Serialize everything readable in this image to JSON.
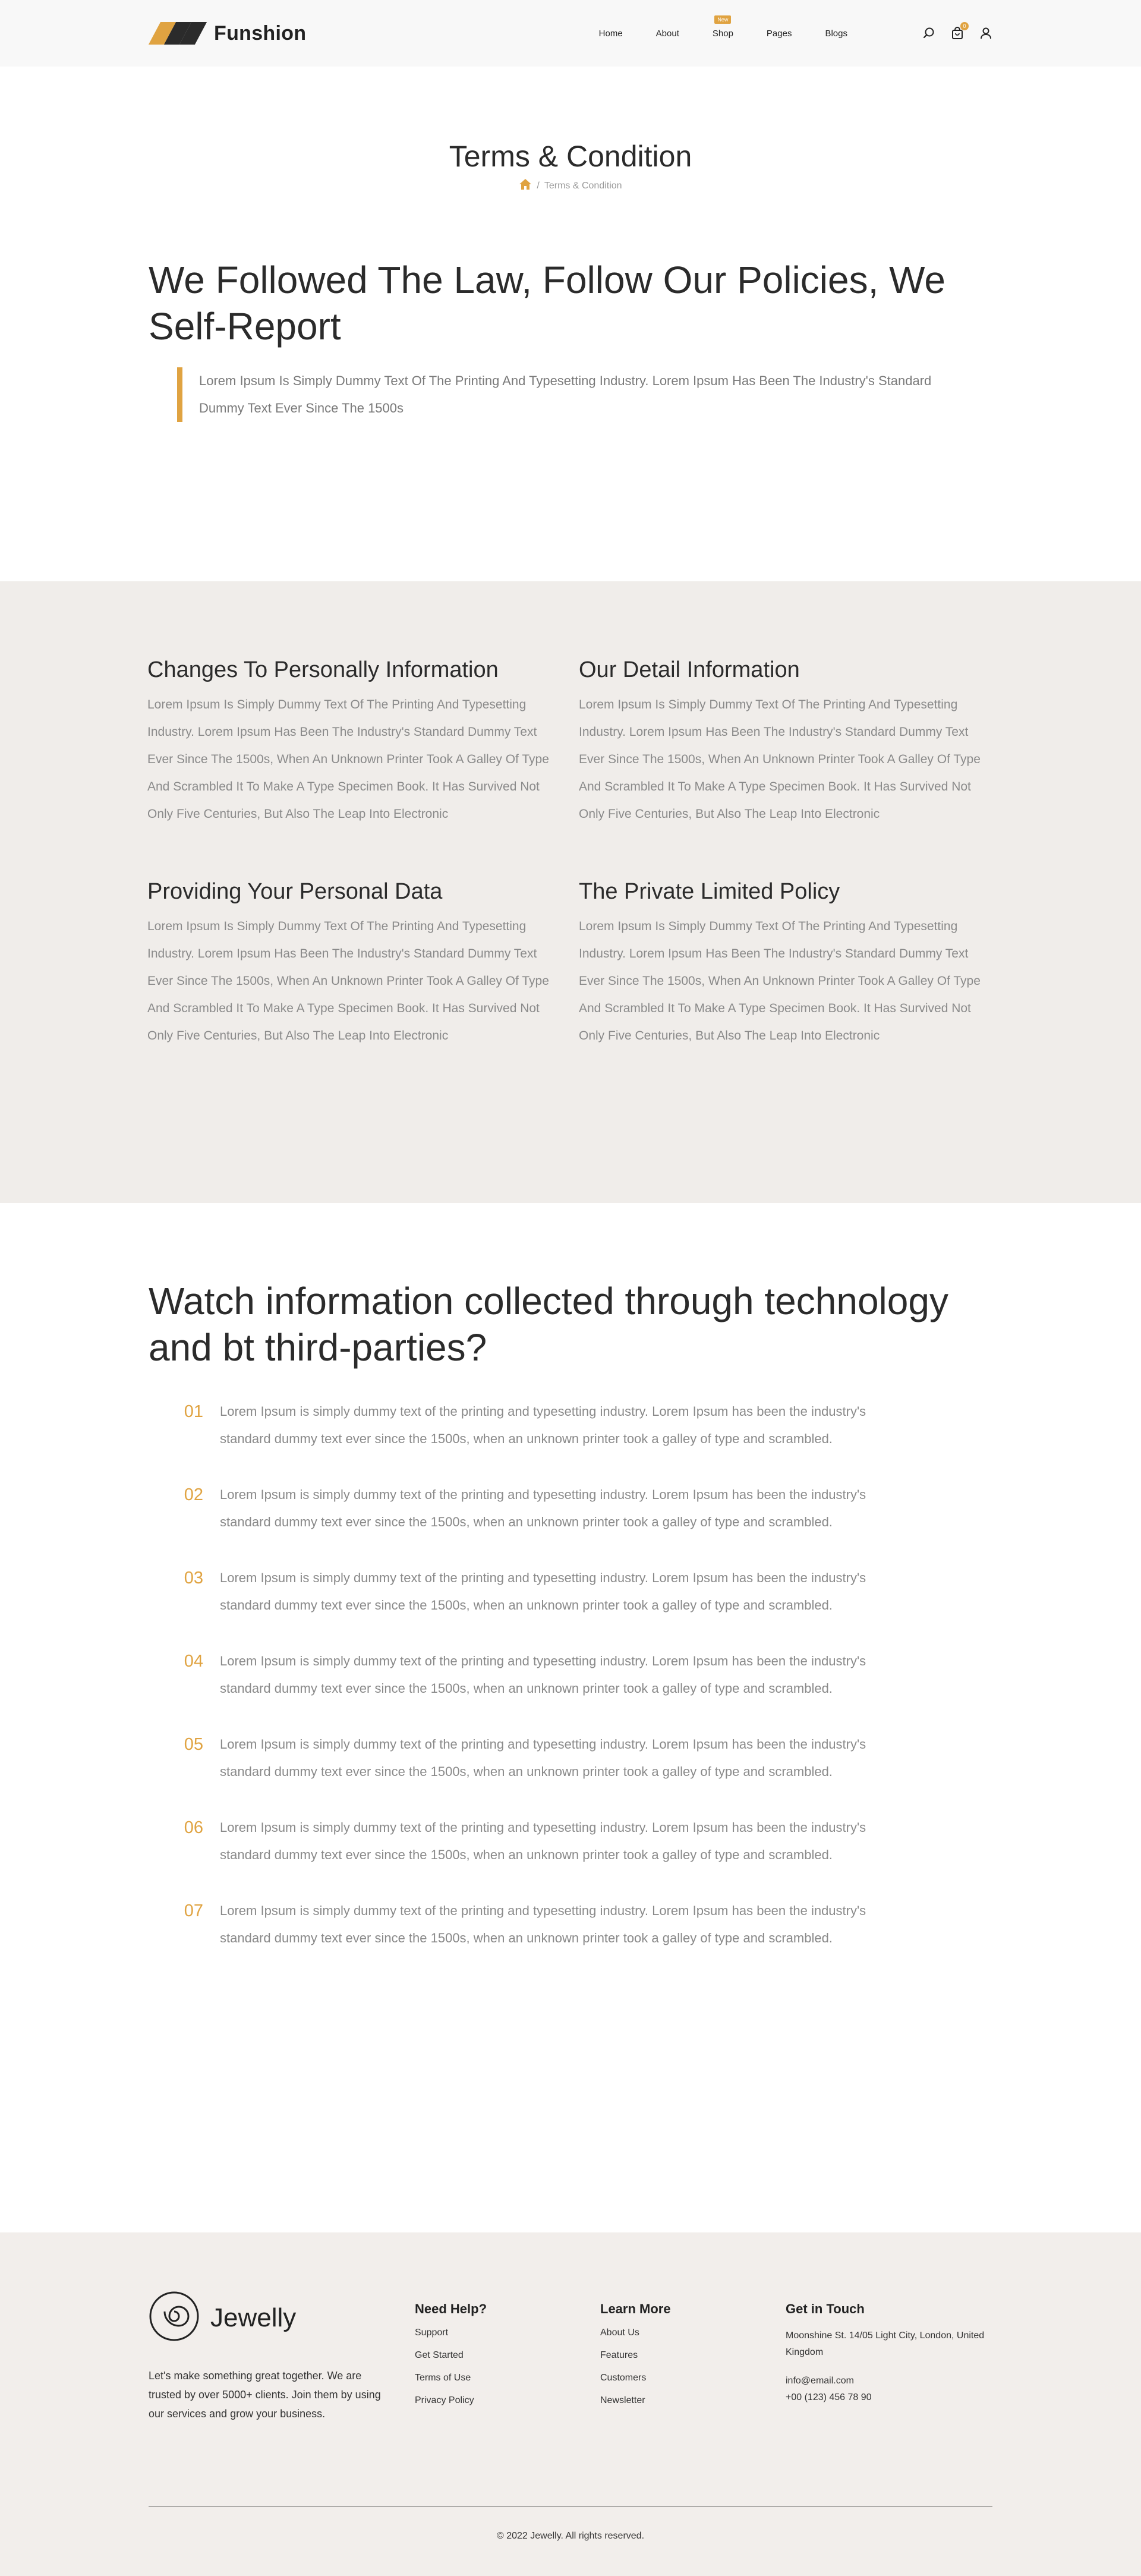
{
  "header": {
    "brand": "Funshion",
    "nav": [
      {
        "label": "Home",
        "badge": ""
      },
      {
        "label": "About",
        "badge": ""
      },
      {
        "label": "Shop",
        "badge": "New"
      },
      {
        "label": "Pages",
        "badge": ""
      },
      {
        "label": "Blogs",
        "badge": ""
      }
    ],
    "cart_count": "0"
  },
  "page": {
    "title": "Terms & Condition",
    "breadcrumb_current": "Terms & Condition"
  },
  "intro": {
    "heading": "We Followed The Law, Follow Our Policies, We Self-Report",
    "quote": "Lorem Ipsum Is Simply Dummy Text Of The Printing And Typesetting Industry. Lorem Ipsum Has Been The Industry's Standard Dummy Text Ever Since The 1500s"
  },
  "sections": [
    {
      "title": "Changes To Personally Information",
      "body": "Lorem Ipsum Is Simply Dummy Text Of The Printing And Typesetting Industry. Lorem Ipsum Has Been The Industry's Standard Dummy Text Ever Since The 1500s, When An Unknown Printer Took A Galley Of Type And Scrambled It To Make A Type Specimen Book. It Has Survived Not Only Five Centuries, But Also The Leap Into Electronic"
    },
    {
      "title": "Our Detail Information",
      "body": "Lorem Ipsum Is Simply Dummy Text Of The Printing And Typesetting Industry. Lorem Ipsum Has Been The Industry's Standard Dummy Text Ever Since The 1500s, When An Unknown Printer Took A Galley Of Type And Scrambled It To Make A Type Specimen Book. It Has Survived Not Only Five Centuries, But Also The Leap Into Electronic"
    },
    {
      "title": "Providing Your Personal Data",
      "body": "Lorem Ipsum Is Simply Dummy Text Of The Printing And Typesetting Industry. Lorem Ipsum Has Been The Industry's Standard Dummy Text Ever Since The 1500s, When An Unknown Printer Took A Galley Of Type And Scrambled It To Make A Type Specimen Book. It Has Survived Not Only Five Centuries, But Also The Leap Into Electronic"
    },
    {
      "title": "The Private Limited Policy",
      "body": "Lorem Ipsum Is Simply Dummy Text Of The Printing And Typesetting Industry. Lorem Ipsum Has Been The Industry's Standard Dummy Text Ever Since The 1500s, When An Unknown Printer Took A Galley Of Type And Scrambled It To Make A Type Specimen Book. It Has Survived Not Only Five Centuries, But Also The Leap Into Electronic"
    }
  ],
  "watch": {
    "heading": "Watch information collected through technology and bt third-parties?",
    "items": [
      {
        "num": "01",
        "text": "Lorem Ipsum is simply dummy text of the printing and typesetting industry. Lorem Ipsum has been the industry's standard dummy text ever since the 1500s, when an unknown printer took a galley of type and scrambled."
      },
      {
        "num": "02",
        "text": "Lorem Ipsum is simply dummy text of the printing and typesetting industry. Lorem Ipsum has been the industry's standard dummy text ever since the 1500s, when an unknown printer took a galley of type and scrambled."
      },
      {
        "num": "03",
        "text": "Lorem Ipsum is simply dummy text of the printing and typesetting industry. Lorem Ipsum has been the industry's standard dummy text ever since the 1500s, when an unknown printer took a galley of type and scrambled."
      },
      {
        "num": "04",
        "text": "Lorem Ipsum is simply dummy text of the printing and typesetting industry. Lorem Ipsum has been the industry's standard dummy text ever since the 1500s, when an unknown printer took a galley of type and scrambled."
      },
      {
        "num": "05",
        "text": "Lorem Ipsum is simply dummy text of the printing and typesetting industry. Lorem Ipsum has been the industry's standard dummy text ever since the 1500s, when an unknown printer took a galley of type and scrambled."
      },
      {
        "num": "06",
        "text": "Lorem Ipsum is simply dummy text of the printing and typesetting industry. Lorem Ipsum has been the industry's standard dummy text ever since the 1500s, when an unknown printer took a galley of type and scrambled."
      },
      {
        "num": "07",
        "text": "Lorem Ipsum is simply dummy text of the printing and typesetting industry. Lorem Ipsum has been the industry's standard dummy text ever since the 1500s, when an unknown printer took a galley of type and scrambled."
      }
    ]
  },
  "footer": {
    "brand": "Jewelly",
    "description": "Let's make something great together. We are trusted by over 5000+ clients. Join them by using our services and grow your business.",
    "need_help": {
      "title": "Need Help?",
      "links": [
        "Support",
        "Get Started",
        "Terms of Use",
        "Privacy Policy"
      ]
    },
    "learn_more": {
      "title": "Learn More",
      "links": [
        "About Us",
        "Features",
        "Customers",
        "Newsletter"
      ]
    },
    "contact": {
      "title": "Get in Touch",
      "address": "Moonshine St. 14/05 Light City, London, United Kingdom",
      "email": "info@email.com",
      "phone": "+00 (123) 456 78 90"
    },
    "copyright": "© 2022 Jewelly. All rights reserved."
  },
  "colors": {
    "accent": "#e0a341",
    "text_dark": "#2b2b2b",
    "text_muted": "#8a8a8a",
    "section_bg": "#f0edea",
    "footer_bg": "#f2eeeb"
  },
  "icons": [
    "home-icon",
    "search-icon",
    "cart-icon",
    "user-icon",
    "spiral-logo-icon"
  ]
}
